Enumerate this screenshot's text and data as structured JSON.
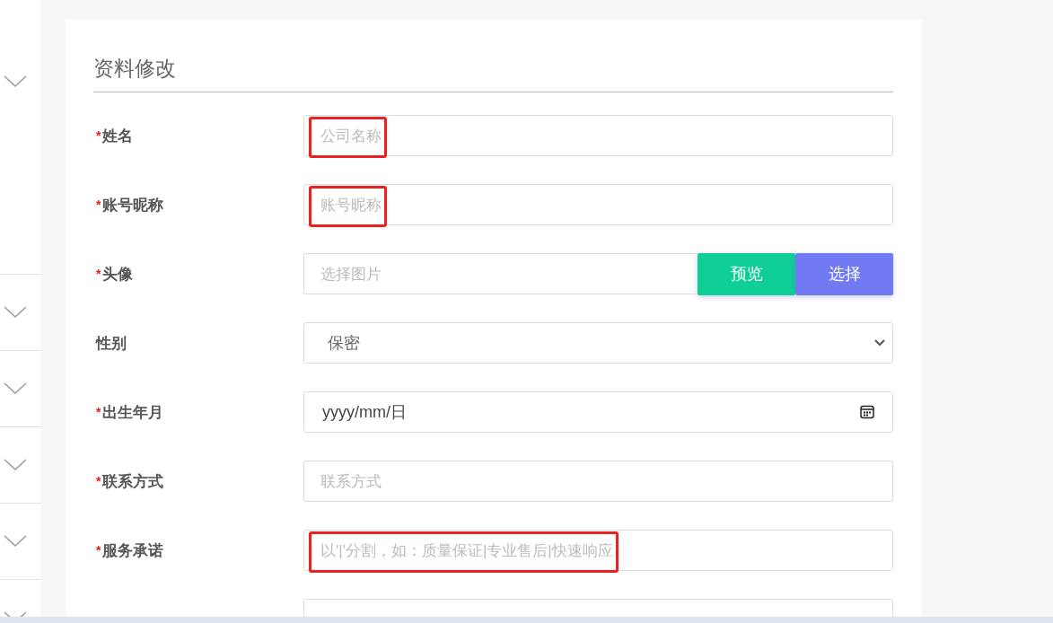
{
  "sidebar": {
    "sections": [
      {
        "expanded": false
      },
      {
        "expanded": false
      },
      {
        "expanded": false
      },
      {
        "expanded": false
      },
      {
        "expanded": false
      },
      {
        "expanded": false
      }
    ]
  },
  "form": {
    "title": "资料修改",
    "fields": [
      {
        "kind": "text",
        "label": "姓名",
        "required_mark": "*",
        "placeholder": "公司名称",
        "highlighted": true
      },
      {
        "kind": "text",
        "label": "账号昵称",
        "required_mark": "*",
        "placeholder": "账号昵称",
        "highlighted": true
      },
      {
        "kind": "image",
        "label": "头像",
        "required_mark": "*",
        "placeholder": "选择图片",
        "buttons": [
          {
            "label": "预览",
            "color": "#0fcf96"
          },
          {
            "label": "选择",
            "color": "#7179f3"
          }
        ]
      },
      {
        "kind": "select",
        "label": "性别",
        "value": "保密"
      },
      {
        "kind": "date",
        "label": "出生年月",
        "required_mark": "*",
        "value": "yyyy/mm/日"
      },
      {
        "kind": "text",
        "label": "联系方式",
        "required_mark": "*",
        "placeholder": "联系方式",
        "highlighted": false
      },
      {
        "kind": "text",
        "label": "服务承诺",
        "required_mark": "*",
        "placeholder": "以'|'分割，如：质量保证|专业售后|快速响应",
        "highlighted": true
      },
      {
        "kind": "text",
        "highlighted": false
      }
    ]
  }
}
